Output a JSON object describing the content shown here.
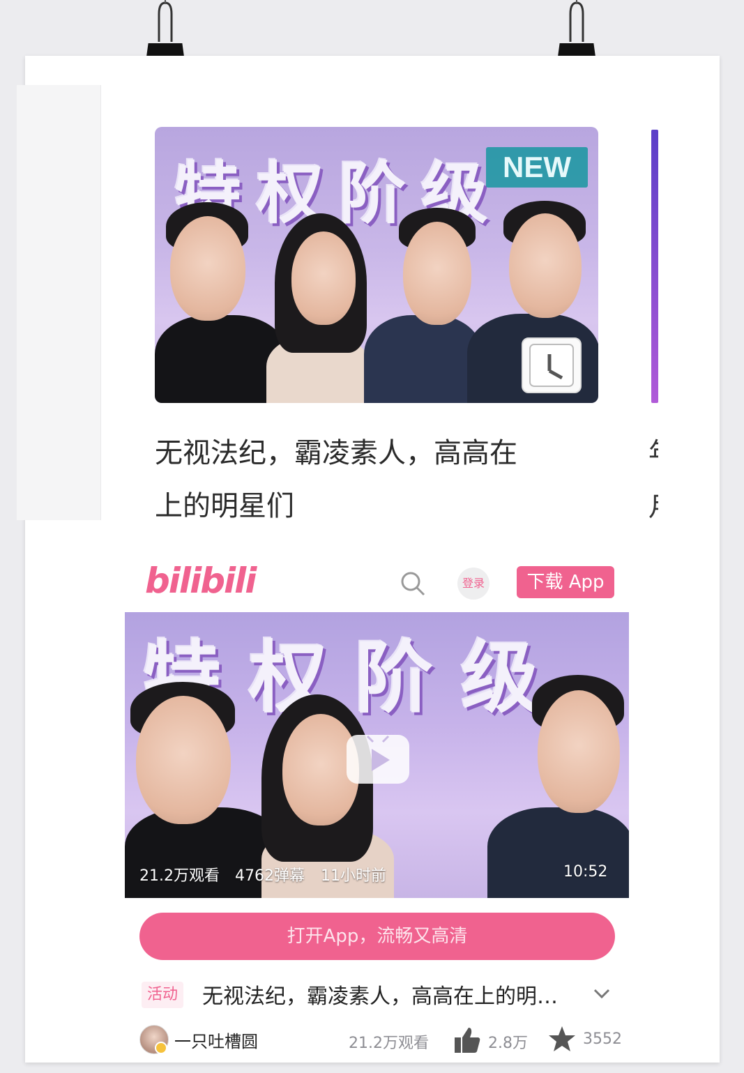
{
  "card": {
    "thumb_title": "特权阶级",
    "badge": "NEW",
    "title_line1": "无视法纪，霸凌素人，高高在",
    "title_line2": "上的明星们"
  },
  "side_card": {
    "line1": "年",
    "line2": "月"
  },
  "header": {
    "logo": "bilibili",
    "login_label": "登录",
    "download_label": "下载 App"
  },
  "video": {
    "cover_title": "特权阶级",
    "views": "21.2万观看",
    "danmaku": "4762弹幕",
    "time_ago": "11小时前",
    "duration": "10:52"
  },
  "open_app_label": "打开App，流畅又高清",
  "info": {
    "tag": "活动",
    "description": "无视法纪，霸凌素人，高高在上的明…",
    "author": "一只吐槽圆",
    "views": "21.2万观看",
    "likes": "2.8万",
    "favorites": "3552"
  },
  "colors": {
    "brand_pink": "#f0628f",
    "thumb_purple": "#c7b3ea"
  }
}
